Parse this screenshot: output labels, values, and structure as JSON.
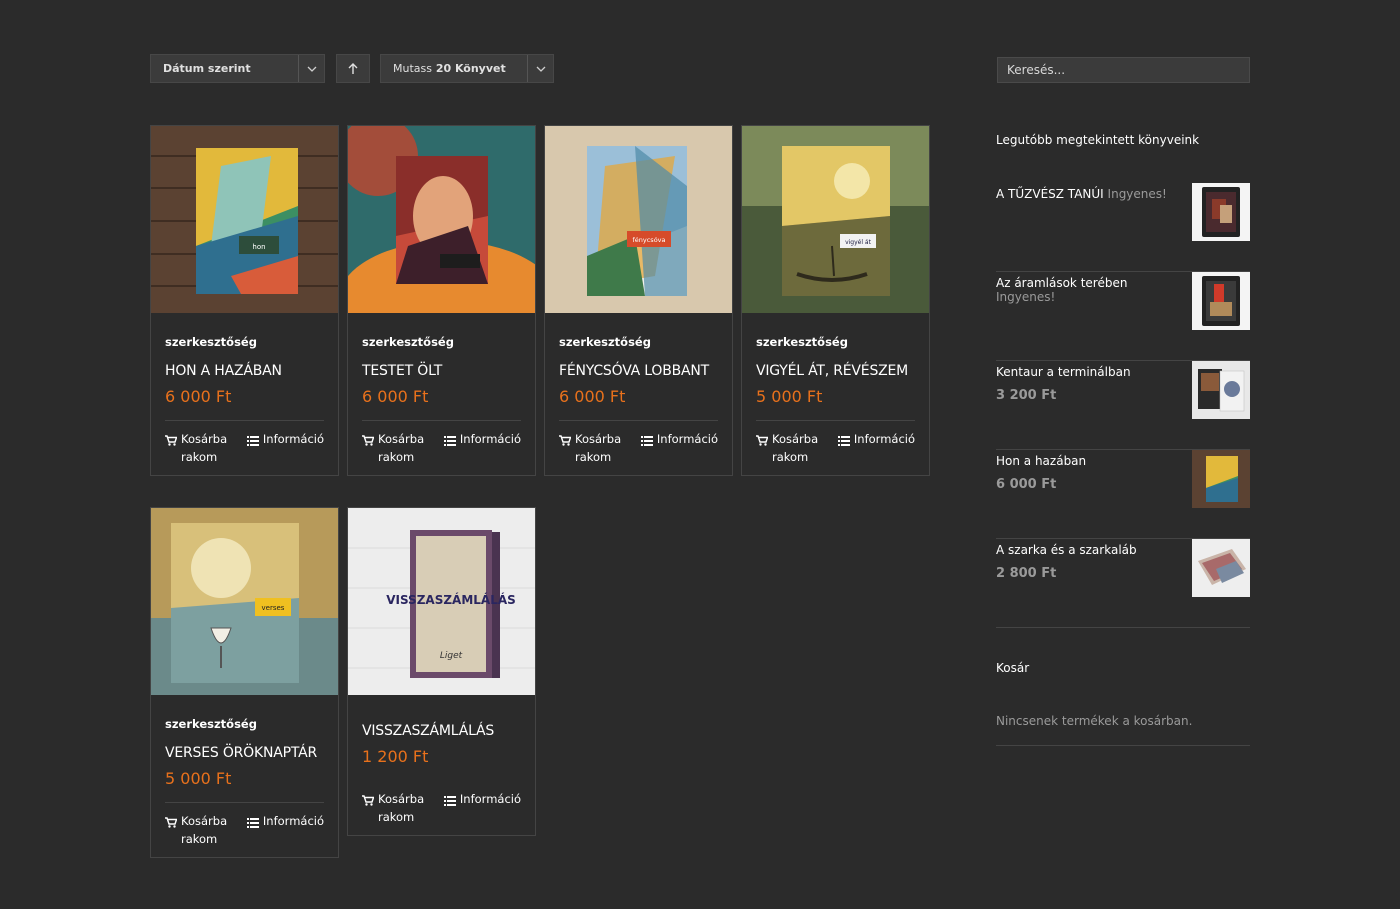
{
  "toolbar": {
    "sort_label": "Dátum szerint",
    "count_prefix": "Mutass",
    "count_value": "20 Könyvet"
  },
  "search": {
    "placeholder": "Keresés..."
  },
  "products": [
    {
      "author": "szerkesztőség",
      "title": "HON A HAZÁBAN",
      "price": "6 000 Ft",
      "cart_label": "Kosárba rakom",
      "info_label": "Információ"
    },
    {
      "author": "szerkesztőség",
      "title": "TESTET ÖLT",
      "price": "6 000 Ft",
      "cart_label": "Kosárba rakom",
      "info_label": "Információ"
    },
    {
      "author": "szerkesztőség",
      "title": "FÉNYCSÓVA LOBBANT",
      "price": "6 000 Ft",
      "cart_label": "Kosárba rakom",
      "info_label": "Információ"
    },
    {
      "author": "szerkesztőség",
      "title": "VIGYÉL ÁT, RÉVÉSZEM",
      "price": "5 000 Ft",
      "cart_label": "Kosárba rakom",
      "info_label": "Információ"
    },
    {
      "author": "szerkesztőség",
      "title": "VERSES ÖRÖKNAPTÁR",
      "price": "5 000 Ft",
      "cart_label": "Kosárba rakom",
      "info_label": "Információ"
    },
    {
      "author": "",
      "title": "VISSZASZÁMLÁLÁS",
      "price": "1 200 Ft",
      "cart_label": "Kosárba rakom",
      "info_label": "Információ"
    }
  ],
  "sidebar": {
    "recent_title": "Legutóbb megtekintett könyveink",
    "recent": [
      {
        "name": "A TŰZVÉSZ TANÚI",
        "free": "Ingyenes!",
        "price": ""
      },
      {
        "name": "Az áramlások terében",
        "free": "Ingyenes!",
        "price": ""
      },
      {
        "name": "Kentaur a terminálban",
        "free": "",
        "price": "3 200 Ft"
      },
      {
        "name": "Hon a hazában",
        "free": "",
        "price": "6 000 Ft"
      },
      {
        "name": "A szarka és a szarkaláb",
        "free": "",
        "price": "2 800 Ft"
      }
    ],
    "cart_title": "Kosár",
    "cart_empty": "Nincsenek termékek a kosárban."
  },
  "cover_texts": {
    "c1": "hon",
    "c3": "fénycsóva",
    "c4": "vigyél át",
    "c5": "verses",
    "c6_title": "VISSZASZÁMLÁLÁS",
    "c6_logo": "Liget"
  },
  "colors": {
    "accent": "#e8711c",
    "background": "#2b2b2b",
    "muted": "#9a9a9a"
  }
}
